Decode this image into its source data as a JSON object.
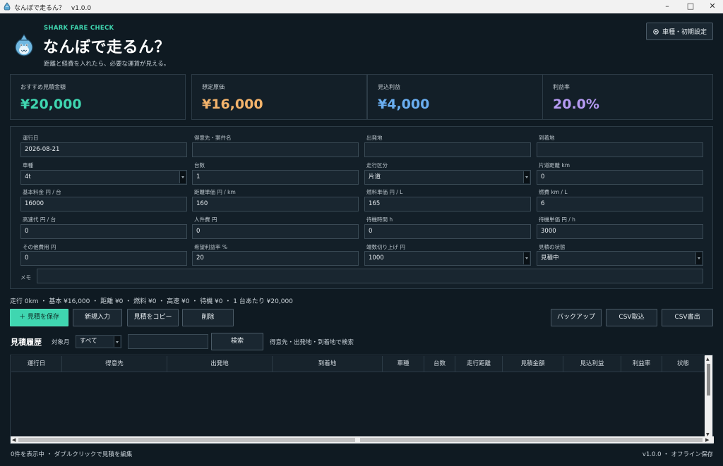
{
  "window": {
    "title": "なんぼで走るん？",
    "version": "v1.0.0"
  },
  "header": {
    "subtitle_en": "SHARK FARE CHECK",
    "title": "なんぼで走るん？",
    "tagline": "距離と経費を入れたら、必要な運賃が見える。",
    "settings_label": "車種・初期設定"
  },
  "stats": [
    {
      "label": "おすすめ見積金額",
      "value": "¥20,000",
      "color": "#3fd6b0"
    },
    {
      "label": "想定原価",
      "value": "¥16,000",
      "color": "#f3b36b"
    },
    {
      "label": "見込利益",
      "value": "¥4,000",
      "color": "#6aaef0"
    },
    {
      "label": "利益率",
      "value": "20.0%",
      "color": "#b69af2"
    }
  ],
  "form": {
    "run_date": {
      "label": "運行日",
      "value": "2026-08-21"
    },
    "client": {
      "label": "得意先・案件名",
      "value": ""
    },
    "origin": {
      "label": "出発地",
      "value": ""
    },
    "destination": {
      "label": "到着地",
      "value": ""
    },
    "vehicle": {
      "label": "車種",
      "value": "4t"
    },
    "units": {
      "label": "台数",
      "value": "1"
    },
    "route_type": {
      "label": "走行区分",
      "value": "片道"
    },
    "one_way_km": {
      "label": "片道距離  km",
      "value": "0"
    },
    "base_fee": {
      "label": "基本料金  円 / 台",
      "value": "16000"
    },
    "distance_rate": {
      "label": "距離単価  円 / km",
      "value": "160"
    },
    "fuel_price": {
      "label": "燃料単価  円 / L",
      "value": "165"
    },
    "fuel_economy": {
      "label": "燃費  km / L",
      "value": "6"
    },
    "toll": {
      "label": "高速代  円 / 台",
      "value": "0"
    },
    "labor": {
      "label": "人件費  円",
      "value": "0"
    },
    "wait_hours": {
      "label": "待機時間  h",
      "value": "0"
    },
    "wait_rate": {
      "label": "待機単価  円 / h",
      "value": "3000"
    },
    "other_cost": {
      "label": "その他費用  円",
      "value": "0"
    },
    "profit_rate": {
      "label": "希望利益率  %",
      "value": "20"
    },
    "rounding": {
      "label": "端数切り上げ  円",
      "value": "1000"
    },
    "status": {
      "label": "見積の状態",
      "value": "見積中"
    },
    "memo": {
      "label": "メモ",
      "value": ""
    }
  },
  "summary": "走行 0km ・ 基本 ¥16,000 ・ 距離 ¥0 ・ 燃料 ¥0 ・ 高速 ¥0 ・ 待機 ¥0 ・ 1 台あたり ¥20,000",
  "actions": {
    "save": "＋ 見積を保存",
    "new": "新規入力",
    "copy": "見積をコピー",
    "delete": "削除",
    "backup": "バックアップ",
    "csv_import": "CSV取込",
    "csv_export": "CSV書出"
  },
  "history": {
    "title": "見積履歴",
    "month_label": "対象月",
    "month_value": "すべて",
    "search_value": "",
    "search_button": "検索",
    "search_hint": "得意先・出発地・到着地で検索",
    "columns": [
      "運行日",
      "得意先",
      "出発地",
      "到着地",
      "車種",
      "台数",
      "走行距離",
      "見積金額",
      "見込利益",
      "利益率",
      "状態"
    ]
  },
  "footer": {
    "left": "0件を表示中 ・ ダブルクリックで見積を編集",
    "right": "v1.0.0 ・ オフライン保存"
  },
  "icons": {
    "app": "shark-icon",
    "settings": "gear-icon"
  }
}
